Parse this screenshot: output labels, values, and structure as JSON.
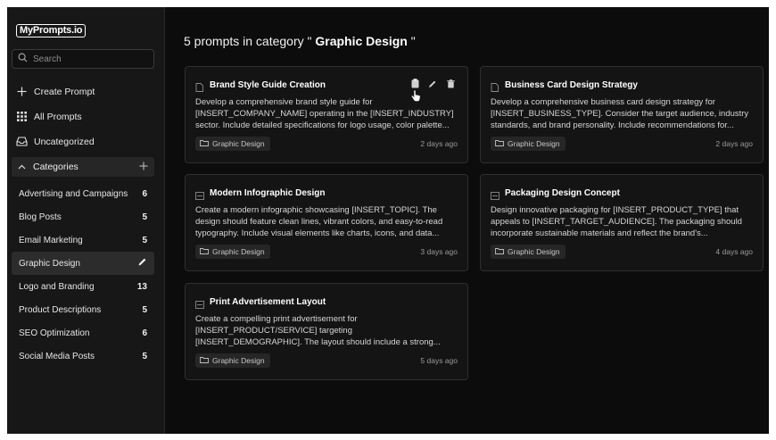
{
  "app": {
    "logo": "MyPrompts.io"
  },
  "search": {
    "placeholder": "Search"
  },
  "nav": {
    "create": "Create Prompt",
    "all": "All Prompts",
    "uncategorized": "Uncategorized",
    "categories": "Categories"
  },
  "categories": [
    {
      "name": "Advertising and Campaigns",
      "count": "6"
    },
    {
      "name": "Blog Posts",
      "count": "5"
    },
    {
      "name": "Email Marketing",
      "count": "5"
    },
    {
      "name": "Graphic Design",
      "count": ""
    },
    {
      "name": "Logo and Branding",
      "count": "13"
    },
    {
      "name": "Product Descriptions",
      "count": "5"
    },
    {
      "name": "SEO Optimization",
      "count": "6"
    },
    {
      "name": "Social Media Posts",
      "count": "5"
    }
  ],
  "header": {
    "prefix": "5 prompts in category \"",
    "category": " Graphic Design ",
    "suffix": "\""
  },
  "prompts": [
    {
      "title": "Brand Style Guide Creation",
      "desc": "Develop a comprehensive brand style guide for [INSERT_COMPANY_NAME] operating in the [INSERT_INDUSTRY] sector. Include detailed specifications for logo usage, color palette...",
      "tag": "Graphic Design",
      "date": "2 days ago"
    },
    {
      "title": "Business Card Design Strategy",
      "desc": "Develop a comprehensive business card design strategy for [INSERT_BUSINESS_TYPE]. Consider the target audience, industry standards, and brand personality. Include recommendations for...",
      "tag": "Graphic Design",
      "date": "2 days ago"
    },
    {
      "title": "Modern Infographic Design",
      "desc": "Create a modern infographic showcasing [INSERT_TOPIC]. The design should feature clean lines, vibrant colors, and easy-to-read typography. Include visual elements like charts, icons, and data...",
      "tag": "Graphic Design",
      "date": "3 days ago"
    },
    {
      "title": "Packaging Design Concept",
      "desc": "Design innovative packaging for [INSERT_PRODUCT_TYPE] that appeals to [INSERT_TARGET_AUDIENCE]. The packaging should incorporate sustainable materials and reflect the brand's...",
      "tag": "Graphic Design",
      "date": "4 days ago"
    },
    {
      "title": "Print Advertisement Layout",
      "desc": "Create a compelling print advertisement for [INSERT_PRODUCT/SERVICE] targeting [INSERT_DEMOGRAPHIC]. The layout should include a strong...",
      "tag": "Graphic Design",
      "date": "5 days ago"
    }
  ],
  "icons": {
    "doc": "document-icon",
    "copy": "clipboard-icon",
    "edit": "pencil-icon",
    "delete": "trash-icon",
    "tag": "folder-icon"
  },
  "colors": {
    "background": "#0c0c0c",
    "sidebar": "#171717",
    "card": "#141414",
    "active": "#2c2c2c"
  }
}
